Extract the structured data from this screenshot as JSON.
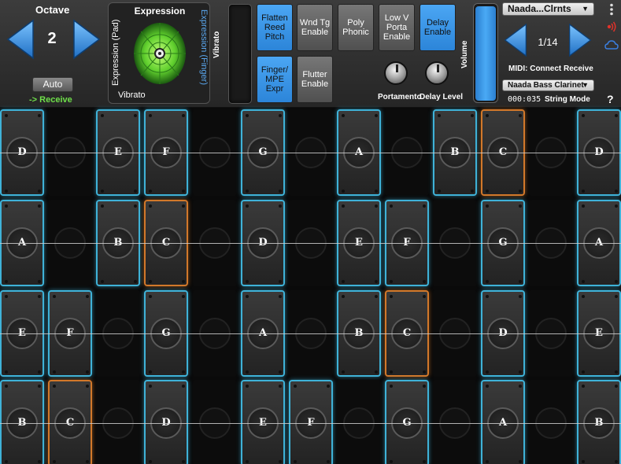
{
  "header": {
    "octave_label": "Octave",
    "octave_value": "2",
    "auto_label": "Auto",
    "receive_label": "-> Receive",
    "expression_title": "Expression",
    "expression_pad_label": "Expression (Pad)",
    "expression_finger_label": "Expression (Finger)",
    "vibrato_pad_label": "Vibrato",
    "vibrato_slider_label": "Vibrato",
    "volume_label": "Volume",
    "portamento_label": "Portamento",
    "delay_level_label": "Delay Level",
    "preset_name": "Naada...Clrnts",
    "preset_count": "1/14",
    "midi_text": "MIDI: Connect Receive",
    "instrument": "Naada Bass Clarinet",
    "counter": "000:035",
    "string_mode": "String Mode",
    "help": "?"
  },
  "toggles": [
    {
      "label": "Flatten Reed Pitch",
      "on": true
    },
    {
      "label": "Wnd Tg Enable",
      "on": false
    },
    {
      "label": "Poly Phonic",
      "on": false
    },
    {
      "label": "Low V Porta Enable",
      "on": false
    },
    {
      "label": "Delay Enable",
      "on": true
    },
    {
      "label": "Finger/ MPE Expr",
      "on": true
    },
    {
      "label": "Flutter Enable",
      "on": false
    }
  ],
  "colors": {
    "accent_blue": "#3fb2d8",
    "c_note_orange": "#d2782a",
    "button_on": "#3a96e6",
    "receive_green": "#6fe04a"
  },
  "grid": {
    "rows": [
      [
        "D",
        "",
        "E",
        "F",
        "",
        "G",
        "",
        "A",
        "",
        "B",
        "C",
        "",
        "D"
      ],
      [
        "A",
        "",
        "B",
        "C",
        "",
        "D",
        "",
        "E",
        "F",
        "",
        "G",
        "",
        "A"
      ],
      [
        "E",
        "F",
        "",
        "G",
        "",
        "A",
        "",
        "B",
        "C",
        "",
        "D",
        "",
        "E"
      ],
      [
        "B",
        "C",
        "",
        "D",
        "",
        "E",
        "F",
        "",
        "G",
        "",
        "A",
        "",
        "B"
      ]
    ]
  }
}
